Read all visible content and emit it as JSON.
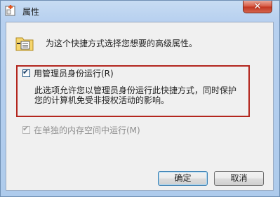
{
  "window": {
    "title": "属性",
    "close_symbol": "✕"
  },
  "dialog": {
    "header_text": "为这个快捷方式选择您想要的高级属性。",
    "run_as_admin": {
      "label": "用管理员身份运行(R)",
      "checked": true,
      "description_line1": "此选项允许您以管理员身份运行此快捷方式，同时保护",
      "description_line2": "您的计算机免受非授权活动的影响。"
    },
    "separate_memory": {
      "label": "在单独的内存空间中运行(M)",
      "checked": true,
      "enabled": false
    },
    "ok_label": "确定",
    "cancel_label": "取消"
  },
  "colors": {
    "highlight_border": "#b3261e",
    "title_bar": "#b9d1ee",
    "close_button": "#d0503a"
  },
  "icons": [
    "shortcut-properties-icon",
    "properties-page-icon",
    "checkmark-icon",
    "close-icon"
  ]
}
